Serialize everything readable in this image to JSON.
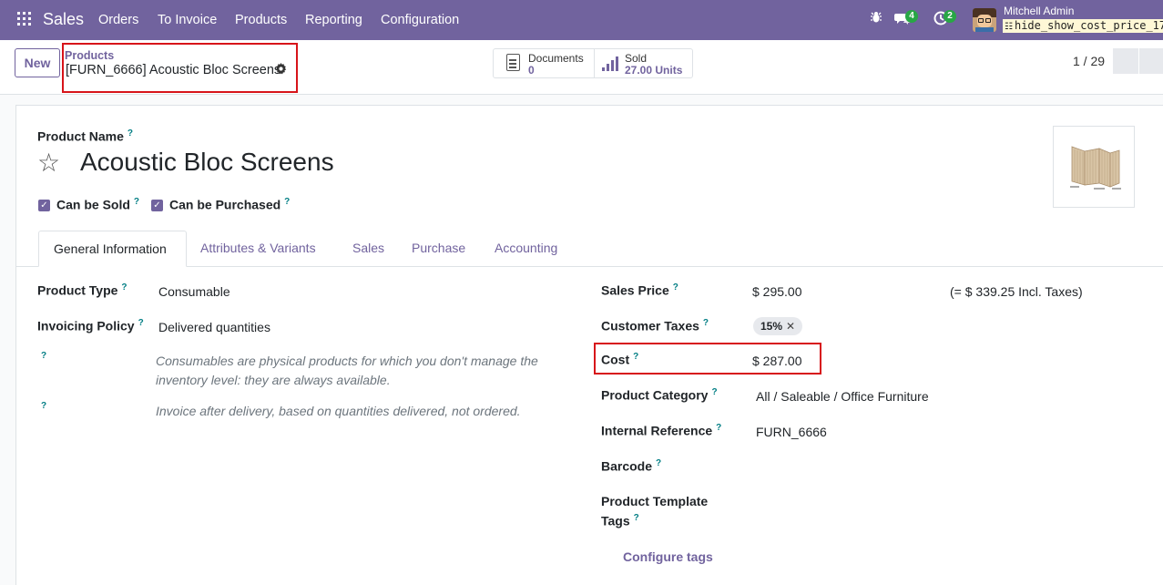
{
  "navbar": {
    "brand": "Sales",
    "menu": [
      "Orders",
      "To Invoice",
      "Products",
      "Reporting",
      "Configuration"
    ],
    "messages_count": "4",
    "activities_count": "2",
    "user_name": "Mitchell Admin",
    "database": "hide_show_cost_price_17"
  },
  "control": {
    "new_label": "New",
    "breadcrumb": "Products",
    "record_title": "[FURN_6666] Acoustic Bloc Screens",
    "documents_label": "Documents",
    "documents_count": "0",
    "sold_label": "Sold",
    "sold_value": "27.00 Units",
    "pager": "1 / 29"
  },
  "form": {
    "product_name_label": "Product Name",
    "product_name": "Acoustic Bloc Screens",
    "can_be_sold": "Can be Sold",
    "can_be_purchased": "Can be Purchased",
    "tabs": [
      "General Information",
      "Attributes & Variants",
      "Sales",
      "Purchase",
      "Accounting"
    ],
    "left": {
      "product_type_label": "Product Type",
      "product_type": "Consumable",
      "invoicing_policy_label": "Invoicing Policy",
      "invoicing_policy": "Delivered quantities",
      "product_type_help_1": "Consumables are physical products for which you don't manage the",
      "product_type_help_2": "inventory level: they are always available.",
      "invoicing_help": "Invoice after delivery, based on quantities delivered, not ordered."
    },
    "right": {
      "sales_price_label": "Sales Price",
      "sales_price": "$ 295.00",
      "incl_taxes": "(= $ 339.25 Incl. Taxes)",
      "customer_taxes_label": "Customer Taxes",
      "customer_tax_tag": "15%",
      "cost_label": "Cost",
      "cost": "$ 287.00",
      "product_category_label": "Product Category",
      "product_category": "All / Saleable / Office Furniture",
      "internal_reference_label": "Internal Reference",
      "internal_reference": "FURN_6666",
      "barcode_label": "Barcode",
      "template_tags_label_1": "Product Template",
      "template_tags_label_2": "Tags",
      "configure_tags": "Configure tags"
    }
  },
  "colors": {
    "brand": "#71639e",
    "highlight": "#d7141a",
    "badge": "#28a745",
    "help": "#017e84"
  }
}
